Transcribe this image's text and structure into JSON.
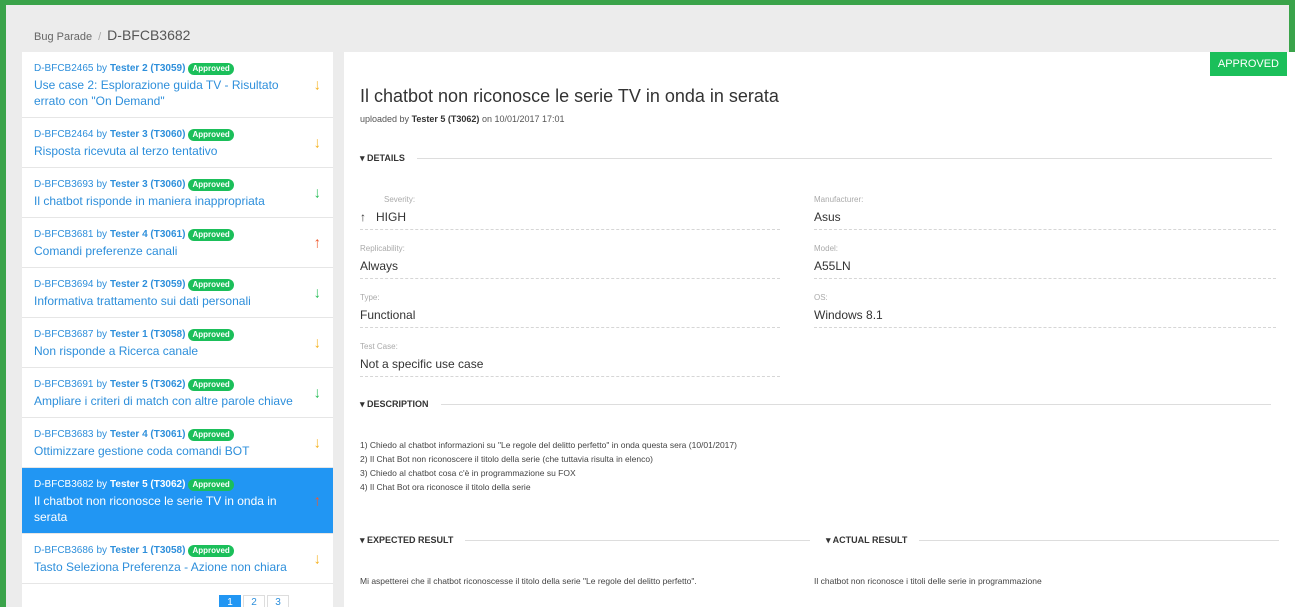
{
  "breadcrumb": {
    "root": "Bug Parade",
    "sep": "/",
    "current": "D-BFCB3682"
  },
  "colors": {
    "accent": "#2196f3",
    "approved": "#1bbf5a",
    "frame": "#3aa34a"
  },
  "list": [
    {
      "id": "D-BFCB2465",
      "by": "by",
      "tester": "Tester 2 (T3059)",
      "badge": "Approved",
      "title": "Use case 2: Esplorazione guida TV - Risultato errato con \"On Demand\"",
      "arrow": "↓",
      "arrow_icon": "arrow-down-yellow"
    },
    {
      "id": "D-BFCB2464",
      "by": "by",
      "tester": "Tester 3 (T3060)",
      "badge": "Approved",
      "title": "Risposta ricevuta al terzo tentativo",
      "arrow": "↓",
      "arrow_icon": "arrow-down-yellow"
    },
    {
      "id": "D-BFCB3693",
      "by": "by",
      "tester": "Tester 3 (T3060)",
      "badge": "Approved",
      "title": "Il chatbot risponde in maniera inappropriata",
      "arrow": "↓",
      "arrow_icon": "arrow-down-green"
    },
    {
      "id": "D-BFCB3681",
      "by": "by",
      "tester": "Tester 4 (T3061)",
      "badge": "Approved",
      "title": "Comandi preferenze canali",
      "arrow": "↑",
      "arrow_icon": "arrow-up-red"
    },
    {
      "id": "D-BFCB3694",
      "by": "by",
      "tester": "Tester 2 (T3059)",
      "badge": "Approved",
      "title": "Informativa trattamento sui dati personali",
      "arrow": "↓",
      "arrow_icon": "arrow-down-green"
    },
    {
      "id": "D-BFCB3687",
      "by": "by",
      "tester": "Tester 1 (T3058)",
      "badge": "Approved",
      "title": "Non risponde a Ricerca canale",
      "arrow": "↓",
      "arrow_icon": "arrow-down-yellow"
    },
    {
      "id": "D-BFCB3691",
      "by": "by",
      "tester": "Tester 5 (T3062)",
      "badge": "Approved",
      "title": "Ampliare i criteri di match con altre parole chiave",
      "arrow": "↓",
      "arrow_icon": "arrow-down-green"
    },
    {
      "id": "D-BFCB3683",
      "by": "by",
      "tester": "Tester 4 (T3061)",
      "badge": "Approved",
      "title": "Ottimizzare gestione coda comandi BOT",
      "arrow": "↓",
      "arrow_icon": "arrow-down-yellow"
    },
    {
      "id": "D-BFCB3682",
      "by": "by",
      "tester": "Tester 5 (T3062)",
      "badge": "Approved",
      "title": "Il chatbot non riconosce le serie TV in onda in serata",
      "arrow": "↑",
      "arrow_icon": "arrow-up-red"
    },
    {
      "id": "D-BFCB3686",
      "by": "by",
      "tester": "Tester 1 (T3058)",
      "badge": "Approved",
      "title": "Tasto Seleziona Preferenza - Azione non chiara",
      "arrow": "↓",
      "arrow_icon": "arrow-down-yellow"
    }
  ],
  "pager": [
    "1",
    "2",
    "3"
  ],
  "detail": {
    "status": "APPROVED",
    "title": "Il chatbot non riconosce le serie TV in onda in serata",
    "uploaded_prefix": "uploaded by",
    "uploaded_by": "Tester 5 (T3062)",
    "uploaded_on": "on 10/01/2017 17:01",
    "details_header": "▾ DETAILS",
    "fields": {
      "severity_label": "Severity:",
      "severity_value": "HIGH",
      "severity_arrow": "↑",
      "manufacturer_label": "Manufacturer:",
      "manufacturer_value": "Asus",
      "replicability_label": "Replicability:",
      "replicability_value": "Always",
      "model_label": "Model:",
      "model_value": "A55LN",
      "type_label": "Type:",
      "type_value": "Functional",
      "os_label": "OS:",
      "os_value": "Windows 8.1",
      "testcase_label": "Test Case:",
      "testcase_value": "Not a specific use case"
    },
    "description_header": "▾ DESCRIPTION",
    "description": [
      "1) Chiedo al chatbot informazioni su \"Le regole del delitto perfetto\" in onda questa sera (10/01/2017)",
      "2) Il Chat Bot non riconoscere il titolo della serie (che tuttavia risulta in elenco)",
      "3) Chiedo al chatbot cosa c'è in programmazione su FOX",
      "4) Il Chat Bot ora riconosce il titolo della serie"
    ],
    "expected_header": "▾ EXPECTED RESULT",
    "expected": "Mi aspetterei che il chatbot riconoscesse il titolo della serie \"Le regole del delitto perfetto\".",
    "actual_header": "▾ ACTUAL RESULT",
    "actual": "Il chatbot non riconosce i titoli delle serie in programmazione"
  }
}
